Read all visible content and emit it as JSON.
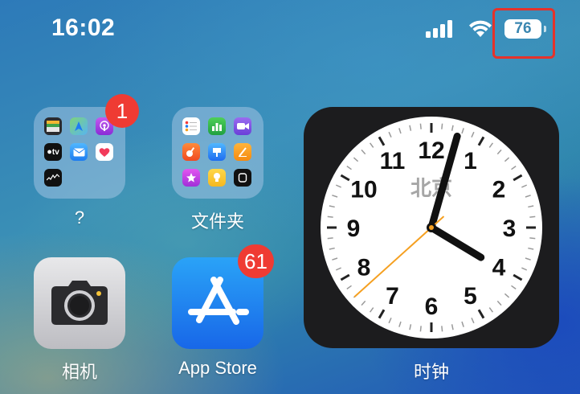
{
  "status_bar": {
    "time": "16:02",
    "battery_level": "76",
    "signal_bars": 4,
    "wifi_icon": "wifi-icon"
  },
  "home_screen": {
    "folder_one": {
      "label": "?",
      "badge": "1",
      "apps": [
        "wallet-icon",
        "maps-icon",
        "podcasts-icon",
        "apple-tv-icon",
        "mail-icon",
        "health-icon",
        "stocks-icon"
      ],
      "tv_text": "tv"
    },
    "folder_two": {
      "label": "文件夹",
      "apps": [
        "reminders-icon",
        "numbers-icon",
        "facetime-icon",
        "garageband-icon",
        "keynote-icon",
        "pages-icon",
        "itunes-store-icon",
        "tips-icon",
        "watch-icon"
      ]
    },
    "camera": {
      "label": "相机"
    },
    "app_store": {
      "label": "App Store",
      "badge": "61"
    },
    "clock_widget": {
      "label": "时钟",
      "city": "北京",
      "numerals": [
        "12",
        "1",
        "2",
        "3",
        "4",
        "5",
        "6",
        "7",
        "8",
        "9",
        "10",
        "11"
      ],
      "hour": 16,
      "minute": 2,
      "second": 38
    }
  },
  "colors": {
    "badge": "#ef3b33",
    "highlight": "#e5322b",
    "second_hand": "#f5a021"
  }
}
